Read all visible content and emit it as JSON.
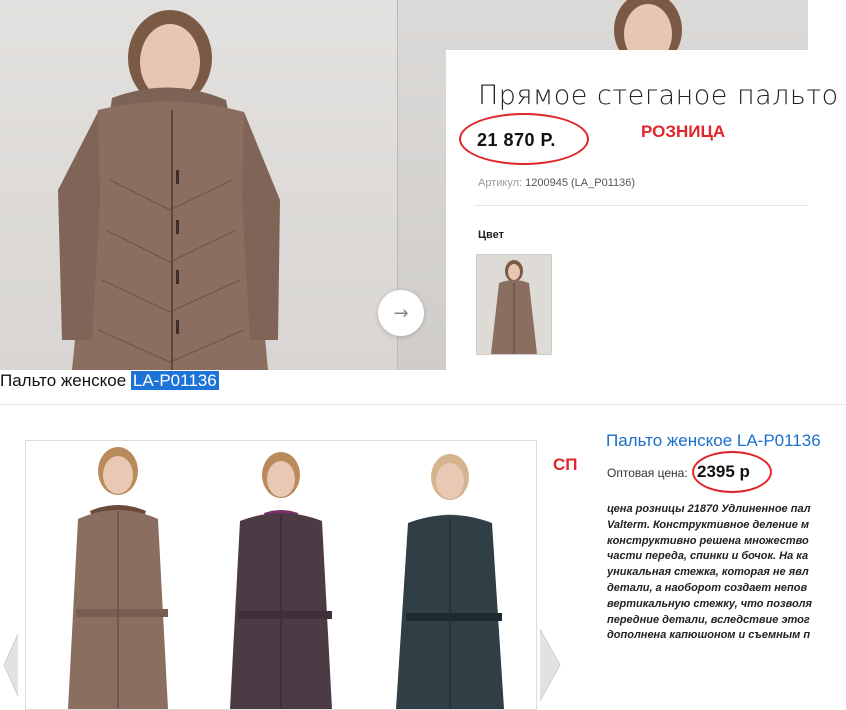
{
  "product": {
    "title": "Прямое стеганое пальто",
    "retail_price": "21 870 Р.",
    "retail_annotation": "РОЗНИЦА",
    "sku_label": "Артикул:",
    "sku_value": "1200945 (LA_P01136)",
    "color_label": "Цвет"
  },
  "caption": {
    "prefix": "Пальто женское ",
    "highlight": "LA-P01136"
  },
  "wholesale": {
    "annotation": "СП",
    "title": "Пальто женское LA-P01136",
    "price_label": "Оптовая цена:",
    "price": "2395 р",
    "description_lines": [
      "цена розницы 21870 Удлиненное пал",
      "Valterm. Конструктивное деление м",
      "конструктивно решена множество",
      "части переда, спинки и бочок. На ка",
      "уникальная стежка, которая не явл",
      "детали, а наоборот создает непов",
      "вертикальную стежку, что позволя",
      "передние детали, вследствие этог",
      "дополнена капюшоном и съемным п"
    ]
  },
  "colors": {
    "accent_red": "#e0262a",
    "link_blue": "#1a6fc9",
    "highlight_blue": "#1d73d6",
    "coat_mocha": "#8a6e60",
    "coat_plum": "#4c3a45",
    "coat_teal": "#2f3f45"
  }
}
